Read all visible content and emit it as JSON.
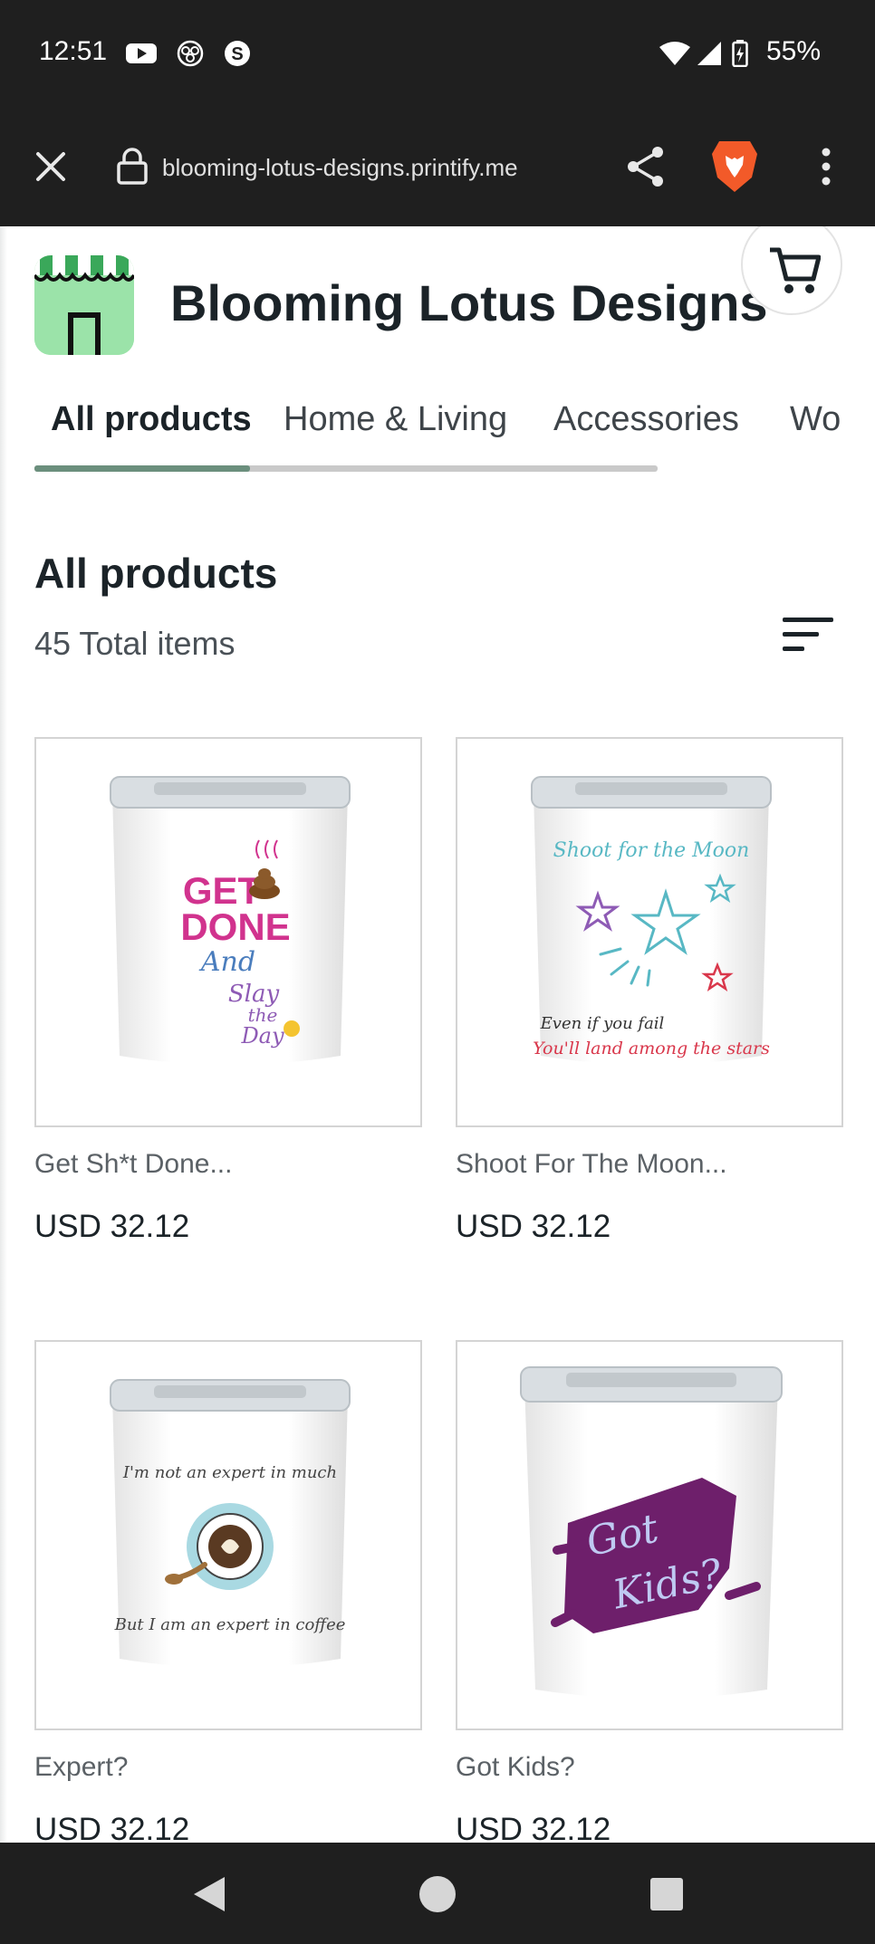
{
  "status_bar": {
    "time": "12:51",
    "battery": "55%",
    "icons": [
      "youtube-icon",
      "app-icon",
      "threads-icon",
      "wifi-icon",
      "signal-icon",
      "battery-icon"
    ]
  },
  "browser": {
    "url": "blooming-lotus-designs.printify.me",
    "icons": [
      "close-icon",
      "lock-icon",
      "share-icon",
      "brave-lion-icon",
      "more-vert-icon"
    ]
  },
  "store": {
    "title": "Blooming Lotus Designs"
  },
  "tabs": [
    {
      "label": "All products",
      "active": true
    },
    {
      "label": "Home & Living",
      "active": false
    },
    {
      "label": "Accessories",
      "active": false
    },
    {
      "label": "Wo",
      "active": false
    }
  ],
  "section": {
    "title": "All products",
    "total": "45 Total items"
  },
  "products": [
    {
      "name": "Get Sh*t Done...",
      "price": "USD 32.12",
      "design_text": [
        "GET",
        "DONE",
        "And",
        "Slay",
        "the",
        "Day"
      ]
    },
    {
      "name": "Shoot For The Moon...",
      "price": "USD 32.12",
      "design_text": [
        "Shoot for the Moon",
        "Even if you fail",
        "You'll land among the stars"
      ]
    },
    {
      "name": "Expert?",
      "price": "USD 32.12",
      "design_text": [
        "I'm not an expert in much",
        "But I am an expert in coffee"
      ]
    },
    {
      "name": "Got Kids?",
      "price": "USD 32.12",
      "design_text": [
        "Got",
        "Kids?"
      ]
    }
  ],
  "colors": {
    "system_bar": "#1f1f1f",
    "accent_tab": "#6b8f7d",
    "logo_green": "#9be3a9",
    "brave_orange": "#f25a29"
  }
}
